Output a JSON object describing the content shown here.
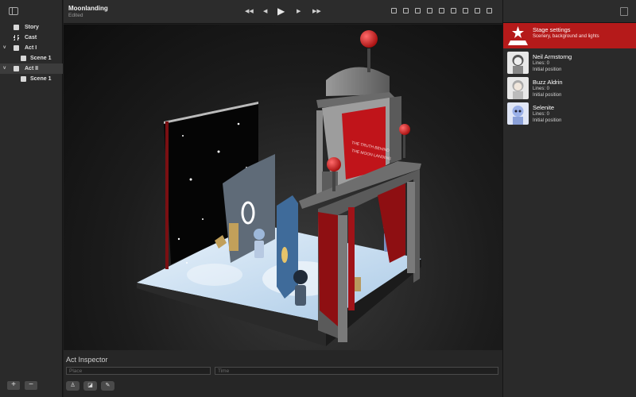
{
  "document": {
    "title": "Moonlanding",
    "status": "Edited"
  },
  "sidebar": {
    "items": [
      {
        "label": "Story",
        "indent": 0,
        "chevron": "",
        "icon": "story-icon"
      },
      {
        "label": "Cast",
        "indent": 0,
        "chevron": "",
        "icon": "cast-icon"
      },
      {
        "label": "Act I",
        "indent": 0,
        "chevron": "v",
        "icon": "act-icon"
      },
      {
        "label": "Scene 1",
        "indent": 1,
        "chevron": "",
        "icon": "scene-icon"
      },
      {
        "label": "Act II",
        "indent": 0,
        "chevron": "v",
        "icon": "act-icon",
        "selected": true
      },
      {
        "label": "Scene 1",
        "indent": 1,
        "chevron": "",
        "icon": "scene-icon"
      }
    ],
    "add_label": "+",
    "remove_label": "−"
  },
  "transport": {
    "rewind": "◀◀",
    "prev": "◀",
    "play": "▶",
    "next": "▶",
    "forward": "▶▶"
  },
  "stage": {
    "sign_text_1": "THE TRUTH BEHIND",
    "sign_text_2": "THE MOON LANDING"
  },
  "inspector": {
    "title": "Act Inspector",
    "place_placeholder": "Place",
    "time_placeholder": "Time"
  },
  "right_panel": {
    "cards": [
      {
        "name": "Stage settings",
        "line1": "Scenery, background and lights",
        "line2": "",
        "active": true,
        "avatar": "star-icon"
      },
      {
        "name": "Neil Armstorng",
        "line1": "Lines: 0",
        "line2": "Initial position",
        "active": false,
        "avatar": "astronaut-avatar"
      },
      {
        "name": "Buzz Aldrin",
        "line1": "Lines: 0",
        "line2": "Initial position",
        "active": false,
        "avatar": "astronaut-avatar"
      },
      {
        "name": "Selenite",
        "line1": "Lines: 0",
        "line2": "Initial position",
        "active": false,
        "avatar": "alien-avatar"
      }
    ]
  },
  "colors": {
    "accent": "#b51a1a",
    "lamp": "#d61f1f",
    "curtain": "#8e0f12",
    "stage_floor": "#cfe3f3"
  }
}
